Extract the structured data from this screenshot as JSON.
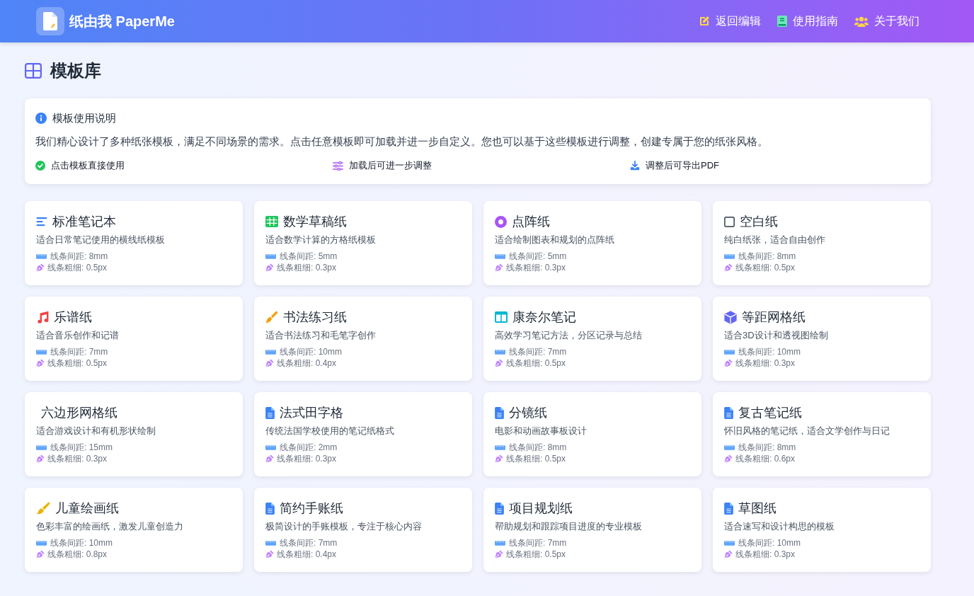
{
  "header": {
    "brand": "纸由我 PaperMe",
    "nav": [
      {
        "kind": "edit",
        "label": "返回编辑"
      },
      {
        "kind": "book",
        "label": "使用指南"
      },
      {
        "kind": "users",
        "label": "关于我们"
      }
    ]
  },
  "page_title": "模板库",
  "info": {
    "title": "模板使用说明",
    "text": "我们精心设计了多种纸张模板，满足不同场景的需求。点击任意模板即可加载并进一步自定义。您也可以基于这些模板进行调整，创建专属于您的纸张风格。",
    "features": [
      {
        "kind": "check",
        "label": "点击模板直接使用"
      },
      {
        "kind": "sliders",
        "label": "加载后可进一步调整"
      },
      {
        "kind": "download",
        "label": "调整后可导出PDF"
      }
    ]
  },
  "templates": [
    {
      "kind": "lines",
      "title": "标准笔记本",
      "description": "适合日常笔记使用的横线纸模板",
      "spacing": "线条间距: 8mm",
      "weight": "线条粗细: 0.5px"
    },
    {
      "kind": "table",
      "title": "数学草稿纸",
      "description": "适合数学计算的方格纸模板",
      "spacing": "线条间距: 5mm",
      "weight": "线条粗细: 0.3px"
    },
    {
      "kind": "ring",
      "title": "点阵纸",
      "description": "适合绘制图表和规划的点阵纸",
      "spacing": "线条间距: 5mm",
      "weight": "线条粗细: 0.3px"
    },
    {
      "kind": "square",
      "title": "空白纸",
      "description": "纯白纸张，适合自由创作",
      "spacing": "线条间距: 8mm",
      "weight": "线条粗细: 0.5px"
    },
    {
      "kind": "music",
      "title": "乐谱纸",
      "description": "适合音乐创作和记谱",
      "spacing": "线条间距: 7mm",
      "weight": "线条粗细: 0.5px"
    },
    {
      "kind": "pen",
      "title": "书法练习纸",
      "description": "适合书法练习和毛笔字创作",
      "spacing": "线条间距: 10mm",
      "weight": "线条粗细: 0.4px"
    },
    {
      "kind": "columns",
      "title": "康奈尔笔记",
      "description": "高效学习笔记方法，分区记录与总结",
      "spacing": "线条间距: 7mm",
      "weight": "线条粗细: 0.5px"
    },
    {
      "kind": "cube",
      "title": "等距网格纸",
      "description": "适合3D设计和透视图绘制",
      "spacing": "线条间距: 10mm",
      "weight": "线条粗细: 0.3px"
    },
    {
      "kind": "none",
      "title": "六边形网格纸",
      "description": "适合游戏设计和有机形状绘制",
      "spacing": "线条间距: 15mm",
      "weight": "线条粗细: 0.3px"
    },
    {
      "kind": "document",
      "title": "法式田字格",
      "description": "传统法国学校使用的笔记纸格式",
      "spacing": "线条间距: 2mm",
      "weight": "线条粗细: 0.3px"
    },
    {
      "kind": "document",
      "title": "分镜纸",
      "description": "电影和动画故事板设计",
      "spacing": "线条间距: 8mm",
      "weight": "线条粗细: 0.5px"
    },
    {
      "kind": "document",
      "title": "复古笔记纸",
      "description": "怀旧风格的笔记纸，适合文学创作与日记",
      "spacing": "线条间距: 8mm",
      "weight": "线条粗细: 0.6px"
    },
    {
      "kind": "brush",
      "title": "儿童绘画纸",
      "description": "色彩丰富的绘画纸，激发儿童创造力",
      "spacing": "线条间距: 10mm",
      "weight": "线条粗细: 0.8px"
    },
    {
      "kind": "document",
      "title": "简约手账纸",
      "description": "极简设计的手账模板，专注于核心内容",
      "spacing": "线条间距: 7mm",
      "weight": "线条粗细: 0.4px"
    },
    {
      "kind": "document",
      "title": "项目规划纸",
      "description": "帮助规划和跟踪项目进度的专业模板",
      "spacing": "线条间距: 7mm",
      "weight": "线条粗细: 0.5px"
    },
    {
      "kind": "document",
      "title": "草图纸",
      "description": "适合速写和设计构思的模板",
      "spacing": "线条间距: 10mm",
      "weight": "线条粗细: 0.3px"
    }
  ]
}
